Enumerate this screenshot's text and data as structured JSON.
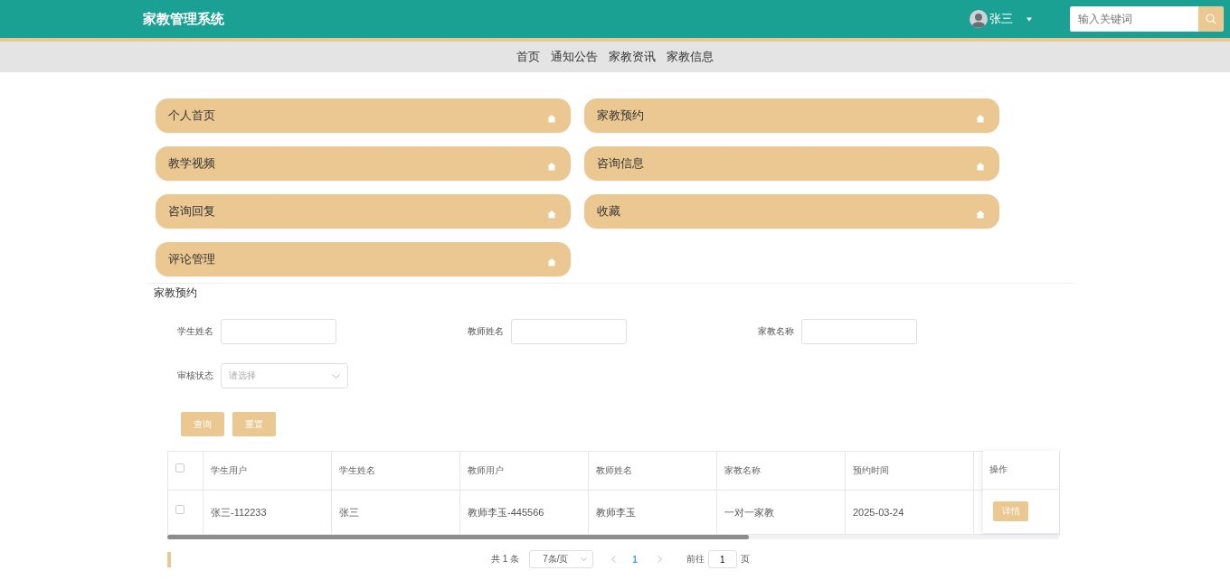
{
  "header": {
    "title": "家教管理系统",
    "user": {
      "name": "张三"
    },
    "search": {
      "placeholder": "输入关键词"
    }
  },
  "nav": [
    "首页",
    "通知公告",
    "家教资讯",
    "家教信息"
  ],
  "menu": [
    "个人首页",
    "家教预约",
    "教学视频",
    "咨询信息",
    "咨询回复",
    "收藏",
    "评论管理"
  ],
  "section_title": "家教预约",
  "filters": [
    {
      "label": "学生姓名",
      "kind": "input"
    },
    {
      "label": "教师姓名",
      "kind": "input"
    },
    {
      "label": "家教名称",
      "kind": "input"
    },
    {
      "label": "审核状态",
      "kind": "select",
      "placeholder": "请选择"
    }
  ],
  "buttons": [
    "查询",
    "重置"
  ],
  "table": {
    "header_checked": false,
    "columns": [
      "学生用户",
      "学生姓名",
      "教师用户",
      "教师姓名",
      "家教名称",
      "预约时间"
    ],
    "action_column": "操作",
    "rows": [
      {
        "checked": false,
        "cells": [
          "张三-112233",
          "张三",
          "教师李玉-445566",
          "教师李玉",
          "一对一家教",
          "2025-03-24"
        ],
        "action": "详情"
      }
    ]
  },
  "pagination": {
    "total": "共 1 条",
    "page_size": "7条/页",
    "pages": [
      {
        "label": "1",
        "selected": true
      }
    ],
    "goto_label": "前往",
    "goto_value": "1",
    "goto_suffix": "页"
  }
}
